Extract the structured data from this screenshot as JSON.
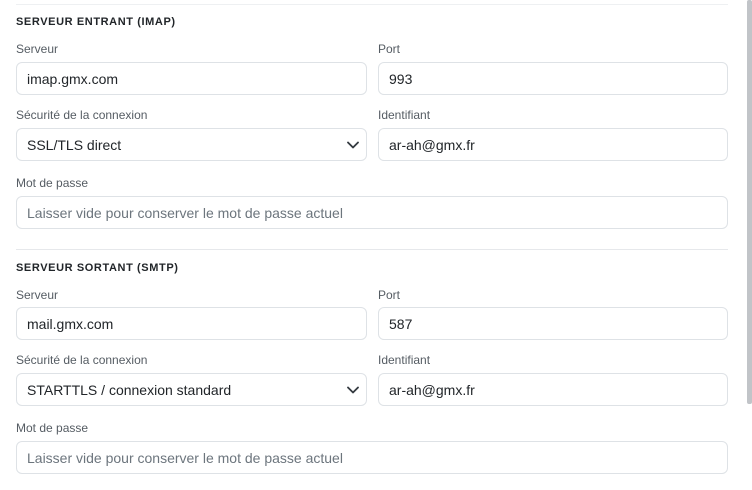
{
  "imap": {
    "title": "SERVEUR ENTRANT (IMAP)",
    "server_label": "Serveur",
    "server_value": "imap.gmx.com",
    "port_label": "Port",
    "port_value": "993",
    "security_label": "Sécurité de la connexion",
    "security_value": "SSL/TLS direct",
    "identifier_label": "Identifiant",
    "identifier_value": "ar-ah@gmx.fr",
    "password_label": "Mot de passe",
    "password_placeholder": "Laisser vide pour conserver le mot de passe actuel"
  },
  "smtp": {
    "title": "SERVEUR SORTANT (SMTP)",
    "server_label": "Serveur",
    "server_value": "mail.gmx.com",
    "port_label": "Port",
    "port_value": "587",
    "security_label": "Sécurité de la connexion",
    "security_value": "STARTTLS / connexion standard",
    "identifier_label": "Identifiant",
    "identifier_value": "ar-ah@gmx.fr",
    "password_label": "Mot de passe",
    "password_placeholder": "Laisser vide pour conserver le mot de passe actuel"
  },
  "icons": {
    "select_arrow": "chevron-down-icon"
  }
}
